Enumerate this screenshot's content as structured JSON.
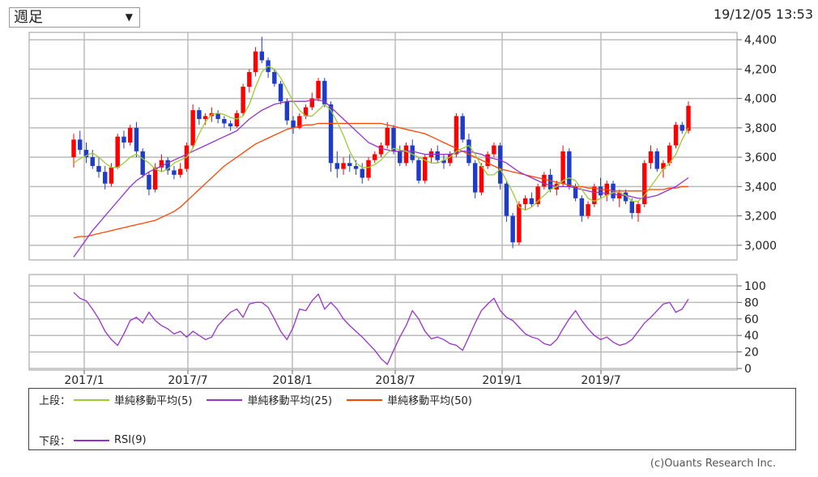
{
  "period_select": {
    "value": "週足"
  },
  "timestamp": "19/12/05 13:53",
  "legend": {
    "upper_label": "上段：",
    "lower_label": "下段：",
    "items_upper": [
      {
        "name": "単純移動平均(5)",
        "color": "#9acd32"
      },
      {
        "name": "単純移動平均(25)",
        "color": "#9932cc"
      },
      {
        "name": "単純移動平均(50)",
        "color": "#ff4500"
      }
    ],
    "items_lower": [
      {
        "name": "RSI(9)",
        "color": "#9932cc"
      }
    ]
  },
  "credit": "(c)Ouants Research Inc.",
  "chart_data": [
    {
      "type": "candlestick",
      "ylim": [
        2900,
        4450
      ],
      "yticks": [
        "4,400",
        "4,200",
        "4,000",
        "3,800",
        "3,600",
        "3,400",
        "3,200",
        "3,000"
      ],
      "ytick_values": [
        4400,
        4200,
        4000,
        3800,
        3600,
        3400,
        3200,
        3000
      ],
      "xticks": [
        "2017/1",
        "2017/7",
        "2018/1",
        "2018/7",
        "2019/1",
        "2019/7"
      ],
      "up_color": "#ff0000",
      "down_color": "#1e3cc8",
      "candles": [
        [
          3600,
          3760,
          3530,
          3720
        ],
        [
          3720,
          3780,
          3620,
          3650
        ],
        [
          3650,
          3700,
          3560,
          3600
        ],
        [
          3600,
          3650,
          3520,
          3540
        ],
        [
          3540,
          3600,
          3460,
          3500
        ],
        [
          3500,
          3540,
          3380,
          3420
        ],
        [
          3420,
          3560,
          3400,
          3530
        ],
        [
          3530,
          3760,
          3520,
          3740
        ],
        [
          3740,
          3780,
          3660,
          3700
        ],
        [
          3700,
          3820,
          3680,
          3800
        ],
        [
          3800,
          3840,
          3600,
          3640
        ],
        [
          3640,
          3660,
          3460,
          3480
        ],
        [
          3480,
          3500,
          3340,
          3380
        ],
        [
          3380,
          3560,
          3360,
          3530
        ],
        [
          3530,
          3620,
          3500,
          3580
        ],
        [
          3580,
          3600,
          3480,
          3510
        ],
        [
          3510,
          3540,
          3450,
          3480
        ],
        [
          3480,
          3560,
          3460,
          3520
        ],
        [
          3520,
          3700,
          3500,
          3680
        ],
        [
          3680,
          3960,
          3660,
          3920
        ],
        [
          3920,
          3940,
          3820,
          3860
        ],
        [
          3860,
          3900,
          3820,
          3880
        ],
        [
          3880,
          3940,
          3840,
          3900
        ],
        [
          3900,
          3920,
          3830,
          3860
        ],
        [
          3860,
          3880,
          3800,
          3830
        ],
        [
          3830,
          3850,
          3780,
          3810
        ],
        [
          3810,
          3920,
          3800,
          3900
        ],
        [
          3900,
          4100,
          3880,
          4080
        ],
        [
          4080,
          4200,
          4040,
          4180
        ],
        [
          4180,
          4350,
          4150,
          4320
        ],
        [
          4320,
          4420,
          4240,
          4260
        ],
        [
          4260,
          4280,
          4140,
          4180
        ],
        [
          4180,
          4200,
          4080,
          4100
        ],
        [
          4100,
          4120,
          3960,
          3980
        ],
        [
          3980,
          4000,
          3820,
          3850
        ],
        [
          3850,
          3880,
          3760,
          3800
        ],
        [
          3800,
          3900,
          3790,
          3880
        ],
        [
          3880,
          3960,
          3860,
          3940
        ],
        [
          3940,
          4040,
          3920,
          4000
        ],
        [
          4000,
          4140,
          3980,
          4120
        ],
        [
          4120,
          4140,
          3940,
          3960
        ],
        [
          3960,
          3980,
          3500,
          3560
        ],
        [
          3560,
          3640,
          3460,
          3520
        ],
        [
          3520,
          3600,
          3480,
          3560
        ],
        [
          3560,
          3620,
          3500,
          3540
        ],
        [
          3540,
          3580,
          3480,
          3520
        ],
        [
          3520,
          3560,
          3420,
          3460
        ],
        [
          3460,
          3600,
          3440,
          3580
        ],
        [
          3580,
          3640,
          3560,
          3620
        ],
        [
          3620,
          3700,
          3600,
          3680
        ],
        [
          3680,
          3840,
          3660,
          3800
        ],
        [
          3800,
          3820,
          3620,
          3640
        ],
        [
          3640,
          3680,
          3540,
          3560
        ],
        [
          3560,
          3700,
          3540,
          3680
        ],
        [
          3680,
          3720,
          3560,
          3580
        ],
        [
          3580,
          3600,
          3420,
          3440
        ],
        [
          3440,
          3620,
          3420,
          3600
        ],
        [
          3600,
          3660,
          3560,
          3640
        ],
        [
          3640,
          3680,
          3560,
          3580
        ],
        [
          3580,
          3620,
          3520,
          3560
        ],
        [
          3560,
          3640,
          3540,
          3620
        ],
        [
          3620,
          3900,
          3600,
          3880
        ],
        [
          3880,
          3900,
          3700,
          3720
        ],
        [
          3720,
          3760,
          3540,
          3560
        ],
        [
          3560,
          3580,
          3320,
          3360
        ],
        [
          3360,
          3560,
          3340,
          3540
        ],
        [
          3540,
          3640,
          3520,
          3620
        ],
        [
          3620,
          3700,
          3600,
          3680
        ],
        [
          3680,
          3700,
          3380,
          3420
        ],
        [
          3420,
          3440,
          3160,
          3200
        ],
        [
          3200,
          3220,
          2980,
          3020
        ],
        [
          3020,
          3300,
          3000,
          3280
        ],
        [
          3280,
          3340,
          3240,
          3320
        ],
        [
          3320,
          3360,
          3260,
          3280
        ],
        [
          3280,
          3420,
          3260,
          3400
        ],
        [
          3400,
          3500,
          3380,
          3480
        ],
        [
          3480,
          3520,
          3360,
          3380
        ],
        [
          3380,
          3440,
          3340,
          3420
        ],
        [
          3420,
          3680,
          3400,
          3640
        ],
        [
          3640,
          3660,
          3380,
          3400
        ],
        [
          3400,
          3420,
          3300,
          3320
        ],
        [
          3320,
          3340,
          3160,
          3200
        ],
        [
          3200,
          3300,
          3180,
          3280
        ],
        [
          3280,
          3420,
          3260,
          3400
        ],
        [
          3400,
          3460,
          3320,
          3340
        ],
        [
          3340,
          3440,
          3300,
          3420
        ],
        [
          3420,
          3440,
          3300,
          3320
        ],
        [
          3320,
          3380,
          3260,
          3360
        ],
        [
          3360,
          3380,
          3280,
          3300
        ],
        [
          3300,
          3320,
          3180,
          3220
        ],
        [
          3220,
          3300,
          3160,
          3280
        ],
        [
          3280,
          3580,
          3260,
          3560
        ],
        [
          3560,
          3680,
          3520,
          3640
        ],
        [
          3640,
          3660,
          3500,
          3520
        ],
        [
          3520,
          3580,
          3460,
          3560
        ],
        [
          3560,
          3700,
          3540,
          3680
        ],
        [
          3680,
          3840,
          3660,
          3820
        ],
        [
          3820,
          3840,
          3760,
          3780
        ],
        [
          3780,
          3980,
          3760,
          3950
        ]
      ],
      "sma5": [
        3560,
        3590,
        3610,
        3630,
        3600,
        3560,
        3530,
        3530,
        3560,
        3600,
        3620,
        3590,
        3560,
        3520,
        3500,
        3520,
        3560,
        3580,
        3600,
        3660,
        3760,
        3840,
        3890,
        3900,
        3890,
        3870,
        3860,
        3880,
        3960,
        4080,
        4180,
        4220,
        4200,
        4140,
        4060,
        3980,
        3920,
        3880,
        3880,
        3920,
        3960,
        3920,
        3840,
        3750,
        3640,
        3560,
        3530,
        3530,
        3550,
        3580,
        3630,
        3660,
        3650,
        3640,
        3620,
        3600,
        3580,
        3560,
        3560,
        3580,
        3600,
        3640,
        3660,
        3680,
        3620,
        3540,
        3480,
        3480,
        3520,
        3440,
        3360,
        3260,
        3240,
        3260,
        3300,
        3340,
        3380,
        3400,
        3440,
        3460,
        3440,
        3380,
        3320,
        3300,
        3320,
        3340,
        3360,
        3360,
        3340,
        3300,
        3300,
        3340,
        3400,
        3460,
        3520,
        3560,
        3620,
        3720,
        3800
      ],
      "sma25": [
        2920,
        2980,
        3040,
        3100,
        3150,
        3200,
        3250,
        3300,
        3350,
        3400,
        3440,
        3470,
        3500,
        3520,
        3540,
        3560,
        3580,
        3600,
        3620,
        3640,
        3660,
        3680,
        3700,
        3720,
        3740,
        3760,
        3780,
        3820,
        3860,
        3890,
        3920,
        3940,
        3960,
        3970,
        3980,
        3980,
        3980,
        3980,
        3990,
        3990,
        3980,
        3940,
        3900,
        3860,
        3820,
        3780,
        3740,
        3700,
        3680,
        3660,
        3650,
        3640,
        3640,
        3640,
        3640,
        3630,
        3620,
        3620,
        3620,
        3620,
        3620,
        3630,
        3640,
        3640,
        3630,
        3620,
        3600,
        3590,
        3580,
        3560,
        3530,
        3500,
        3480,
        3460,
        3440,
        3420,
        3410,
        3400,
        3400,
        3400,
        3390,
        3380,
        3370,
        3360,
        3360,
        3350,
        3350,
        3340,
        3340,
        3330,
        3320,
        3320,
        3330,
        3340,
        3360,
        3380,
        3400,
        3430,
        3460
      ],
      "sma50": [
        3050,
        3060,
        3060,
        3070,
        3080,
        3090,
        3100,
        3110,
        3120,
        3130,
        3140,
        3150,
        3160,
        3170,
        3190,
        3210,
        3230,
        3260,
        3300,
        3340,
        3380,
        3420,
        3460,
        3500,
        3540,
        3570,
        3600,
        3630,
        3660,
        3690,
        3710,
        3730,
        3750,
        3770,
        3790,
        3800,
        3810,
        3820,
        3820,
        3830,
        3830,
        3830,
        3830,
        3830,
        3830,
        3830,
        3830,
        3830,
        3830,
        3830,
        3820,
        3810,
        3800,
        3790,
        3780,
        3770,
        3760,
        3740,
        3720,
        3700,
        3680,
        3660,
        3640,
        3620,
        3600,
        3580,
        3560,
        3540,
        3520,
        3510,
        3500,
        3490,
        3480,
        3470,
        3460,
        3450,
        3440,
        3430,
        3420,
        3410,
        3400,
        3400,
        3390,
        3390,
        3380,
        3380,
        3370,
        3370,
        3370,
        3370,
        3370,
        3370,
        3380,
        3380,
        3380,
        3390,
        3390,
        3400,
        3400
      ]
    },
    {
      "type": "line",
      "ylim": [
        0,
        100
      ],
      "yticks": [
        "100",
        "80",
        "60",
        "40",
        "20",
        "0"
      ],
      "ytick_values": [
        100,
        80,
        60,
        40,
        20,
        0
      ],
      "series": [
        {
          "name": "RSI(9)",
          "color": "#9932cc",
          "values": [
            92,
            85,
            82,
            72,
            60,
            45,
            35,
            28,
            42,
            58,
            62,
            55,
            68,
            58,
            52,
            48,
            42,
            45,
            38,
            45,
            40,
            35,
            38,
            52,
            60,
            68,
            72,
            62,
            78,
            80,
            80,
            74,
            60,
            45,
            35,
            50,
            72,
            70,
            82,
            90,
            72,
            80,
            72,
            60,
            52,
            45,
            38,
            30,
            22,
            12,
            5,
            22,
            38,
            52,
            70,
            60,
            45,
            36,
            38,
            35,
            30,
            28,
            22,
            38,
            55,
            70,
            78,
            85,
            70,
            62,
            58,
            50,
            42,
            38,
            36,
            30,
            28,
            35,
            48,
            60,
            70,
            58,
            48,
            40,
            35,
            38,
            32,
            28,
            30,
            35,
            45,
            55,
            62,
            70,
            78,
            80,
            68,
            72,
            84
          ]
        }
      ]
    }
  ]
}
